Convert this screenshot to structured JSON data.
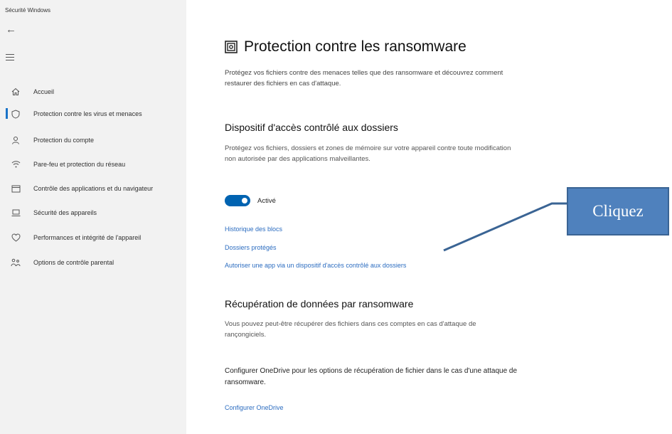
{
  "window": {
    "title": "Sécurité Windows"
  },
  "sidebar": {
    "items": [
      {
        "label": "Accueil",
        "icon": "home-icon"
      },
      {
        "label": "Protection contre les virus et menaces",
        "icon": "shield-icon",
        "selected": true
      },
      {
        "label": "Protection du compte",
        "icon": "person-icon"
      },
      {
        "label": "Pare-feu et protection du réseau",
        "icon": "wifi-icon"
      },
      {
        "label": "Contrôle des applications et du navigateur",
        "icon": "browser-window-icon"
      },
      {
        "label": "Sécurité des appareils",
        "icon": "device-icon"
      },
      {
        "label": "Performances et intégrité de l'appareil",
        "icon": "heart-icon"
      },
      {
        "label": "Options de contrôle parental",
        "icon": "family-icon"
      }
    ]
  },
  "main": {
    "title": "Protection contre les ransomware",
    "description": "Protégez vos fichiers contre des menaces telles que des ransomware et découvrez comment restaurer des fichiers en cas d'attaque.",
    "cfa": {
      "heading": "Dispositif d'accès contrôlé aux dossiers",
      "description": "Protégez vos fichiers, dossiers et zones de mémoire sur votre appareil contre toute modification non autorisée par des applications malveillantes.",
      "toggle_state": "Activé",
      "toggle_on": true,
      "links": {
        "history": "Historique des blocs",
        "protected_folders": "Dossiers protégés",
        "allow_app": "Autoriser une app via un dispositif d'accès contrôlé aux dossiers"
      }
    },
    "recovery": {
      "heading": "Récupération de données par ransomware",
      "description": "Vous pouvez peut-être récupérer des fichiers dans ces comptes en cas d'attaque de rançongiciels.",
      "onedrive_text": "Configurer OneDrive pour les options de récupération de fichier dans le cas d'une attaque de ransomware.",
      "onedrive_link": "Configurer OneDrive"
    }
  },
  "callout": {
    "label": "Cliquez",
    "fill": "#4f81bd",
    "line_color": "#3a6494"
  },
  "colors": {
    "accent": "#0063b1",
    "link": "#2b6cc0",
    "sidebar_bg": "#f2f2f2"
  }
}
